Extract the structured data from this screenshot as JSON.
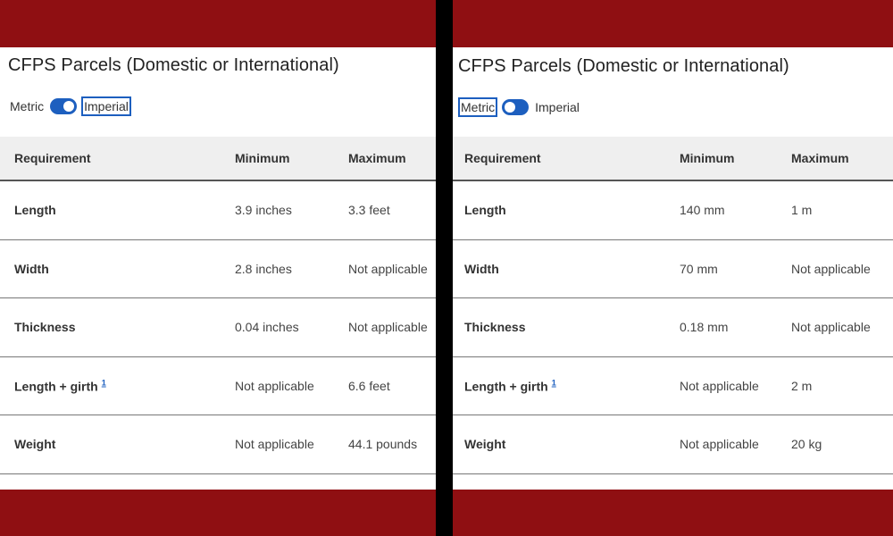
{
  "left_panel": {
    "title": "CFPS Parcels (Domestic or International)",
    "toggle": {
      "metric_label": "Metric",
      "imperial_label": "Imperial",
      "selected": "Imperial"
    },
    "table": {
      "headers": [
        "Requirement",
        "Minimum",
        "Maximum"
      ],
      "rows": [
        {
          "requirement": "Length",
          "minimum": "3.9 inches",
          "maximum": "3.3 feet"
        },
        {
          "requirement": "Width",
          "minimum": "2.8 inches",
          "maximum": "Not applicable"
        },
        {
          "requirement": "Thickness",
          "minimum": "0.04 inches",
          "maximum": "Not applicable"
        },
        {
          "requirement": "Length + girth",
          "footnote": "1",
          "minimum": "Not applicable",
          "maximum": "6.6 feet"
        },
        {
          "requirement": "Weight",
          "minimum": "Not applicable",
          "maximum": "44.1 pounds"
        }
      ]
    }
  },
  "right_panel": {
    "title": "CFPS Parcels (Domestic or International)",
    "toggle": {
      "metric_label": "Metric",
      "imperial_label": "Imperial",
      "selected": "Metric"
    },
    "table": {
      "headers": [
        "Requirement",
        "Minimum",
        "Maximum"
      ],
      "rows": [
        {
          "requirement": "Length",
          "minimum": "140 mm",
          "maximum": "1 m"
        },
        {
          "requirement": "Width",
          "minimum": "70 mm",
          "maximum": "Not applicable"
        },
        {
          "requirement": "Thickness",
          "minimum": "0.18 mm",
          "maximum": "Not applicable"
        },
        {
          "requirement": "Length + girth",
          "footnote": "1",
          "minimum": "Not applicable",
          "maximum": "2 m"
        },
        {
          "requirement": "Weight",
          "minimum": "Not applicable",
          "maximum": "20 kg"
        }
      ]
    }
  },
  "colors": {
    "brand_red": "#8f0f12",
    "accent_blue": "#1d5fbf",
    "header_bg": "#efefef"
  }
}
